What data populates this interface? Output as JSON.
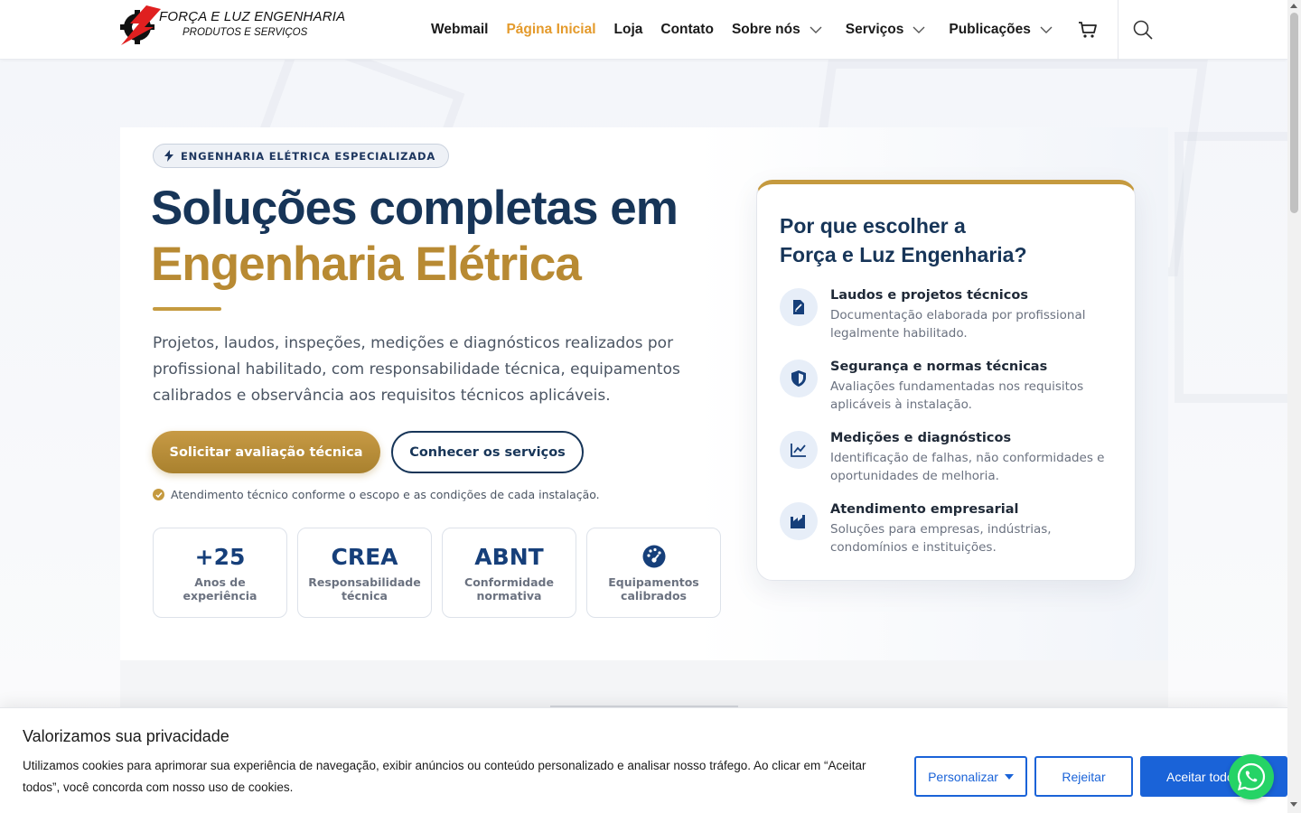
{
  "header": {
    "logo_line1": "FORÇA E LUZ ENGENHARIA",
    "logo_line2": "PRODUTOS E SERVIÇOS",
    "nav": [
      {
        "label": "Webmail",
        "active": false,
        "dropdown": false
      },
      {
        "label": "Página Inicial",
        "active": true,
        "dropdown": false
      },
      {
        "label": "Loja",
        "active": false,
        "dropdown": false
      },
      {
        "label": "Contato",
        "active": false,
        "dropdown": false
      },
      {
        "label": "Sobre nós",
        "active": false,
        "dropdown": true
      },
      {
        "label": "Serviços",
        "active": false,
        "dropdown": true
      },
      {
        "label": "Publicações",
        "active": false,
        "dropdown": true
      }
    ],
    "cart_icon": "cart-icon",
    "search_icon": "search-icon"
  },
  "hero": {
    "badge": "ENGENHARIA ELÉTRICA ESPECIALIZADA",
    "title_line1": "Soluções completas em",
    "title_line2": "Engenharia Elétrica",
    "lead": "Projetos, laudos, inspeções, medições e diagnósticos realizados por profissional habilitado, com responsabilidade técnica, equipamentos calibrados e observância aos requisitos técnicos aplicáveis.",
    "primary_button": "Solicitar avaliação técnica",
    "secondary_button": "Conhecer os serviços",
    "note": "Atendimento técnico conforme o escopo e as condições de cada instalação.",
    "stats": [
      {
        "value": "+25",
        "label": "Anos de experiência",
        "icon": ""
      },
      {
        "value": "CREA",
        "label": "Responsabilidade técnica",
        "icon": ""
      },
      {
        "value": "ABNT",
        "label": "Conformidade normativa",
        "icon": ""
      },
      {
        "value": "",
        "label": "Equipamentos calibrados",
        "icon": "gauge-icon"
      }
    ]
  },
  "why": {
    "title_line1": "Por que escolher a",
    "title_line2": "Força e Luz Engenharia?",
    "items": [
      {
        "title": "Laudos e projetos técnicos",
        "text": "Documentação elaborada por profissional legalmente habilitado.",
        "icon": "document-edit-icon"
      },
      {
        "title": "Segurança e normas técnicas",
        "text": "Avaliações fundamentadas nos requisitos aplicáveis à instalação.",
        "icon": "shield-icon"
      },
      {
        "title": "Medições e diagnósticos",
        "text": "Identificação de falhas, não conformidades e oportunidades de melhoria.",
        "icon": "chart-line-icon"
      },
      {
        "title": "Atendimento empresarial",
        "text": "Soluções para empresas, indústrias, condomínios e instituições.",
        "icon": "factory-icon"
      }
    ]
  },
  "cookie": {
    "title": "Valorizamos sua privacidade",
    "text": "Utilizamos cookies para aprimorar sua experiência de navegação, exibir anúncios ou conteúdo personalizado e analisar nosso tráfego. Ao clicar em “Aceitar todos”, você concorda com nosso uso de cookies.",
    "customize": "Personalizar",
    "reject": "Rejeitar",
    "accept": "Aceitar todos"
  },
  "colors": {
    "navy": "#173558",
    "gold": "#b88a33",
    "active_nav": "#e49a2b",
    "cookie_blue": "#1a63d8",
    "whatsapp": "#25d366"
  }
}
